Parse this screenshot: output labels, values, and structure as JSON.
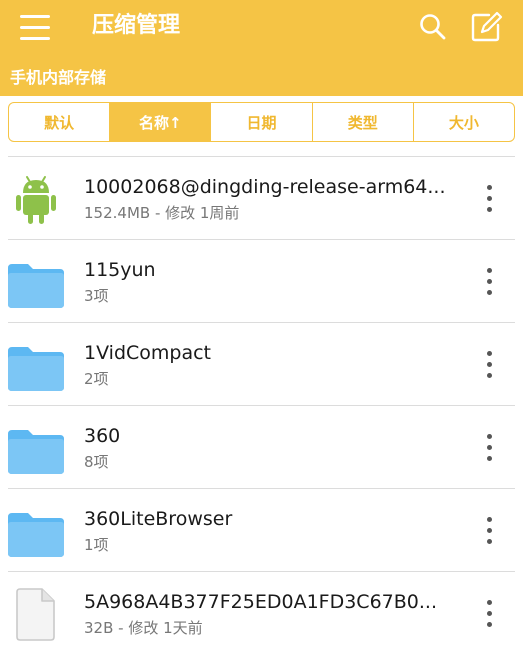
{
  "appbar": {
    "title": "压缩管理",
    "subtitle": "手机内部存储",
    "menu_icon": "hamburger-menu-icon",
    "search_icon": "search-icon",
    "edit_icon": "edit-icon",
    "color": "#f5c445"
  },
  "sort": {
    "options": [
      "默认",
      "名称↑",
      "日期",
      "类型",
      "大小"
    ],
    "active": "名称↑"
  },
  "files": [
    {
      "name": "10002068@dingding-release-arm64...",
      "meta": "152.4MB - 修改 1周前",
      "icon": "android-apk-icon"
    },
    {
      "name": "115yun",
      "meta": "3项",
      "icon": "folder-icon"
    },
    {
      "name": "1VidCompact",
      "meta": "2项",
      "icon": "folder-icon"
    },
    {
      "name": "360",
      "meta": "8项",
      "icon": "folder-icon"
    },
    {
      "name": "360LiteBrowser",
      "meta": "1项",
      "icon": "folder-icon"
    },
    {
      "name": "5A968A4B377F25ED0A1FD3C67B0...",
      "meta": "32B - 修改 1天前",
      "icon": "file-icon"
    }
  ],
  "colors": {
    "folder": "#5db8f2",
    "android": "#8ec14a",
    "accent": "#f5c445"
  }
}
